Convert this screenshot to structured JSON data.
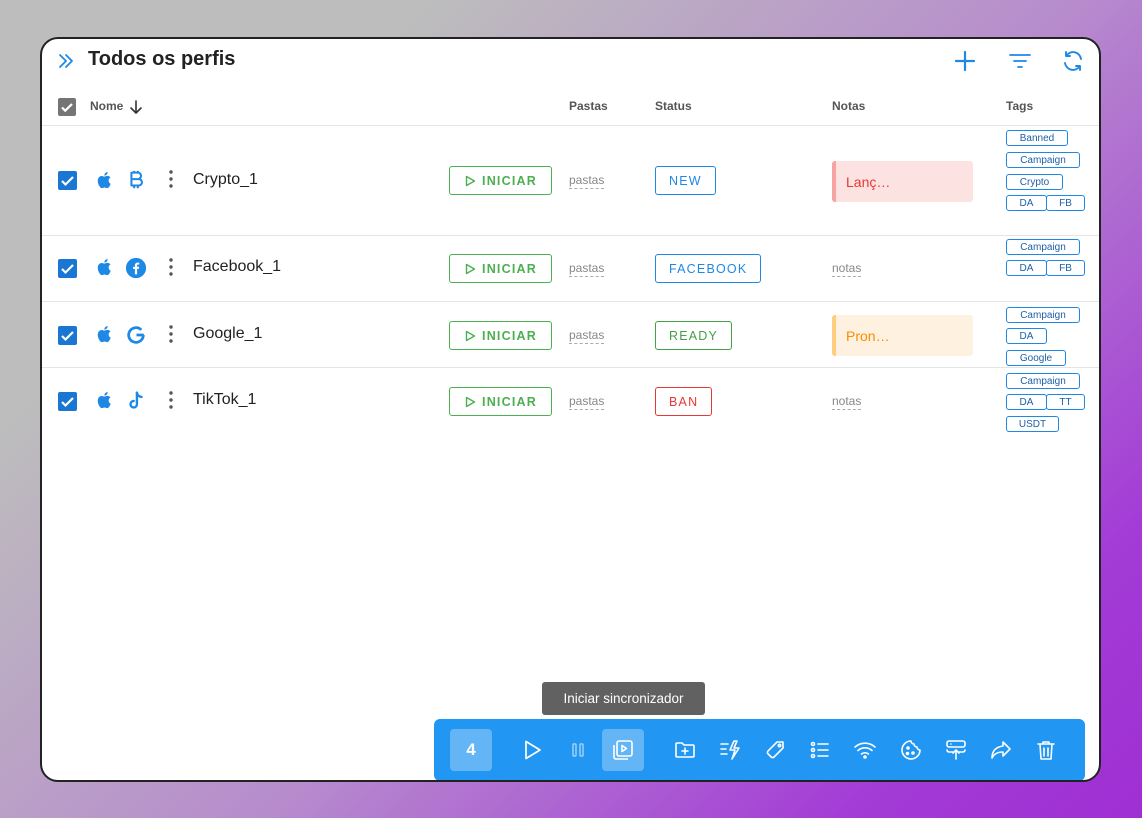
{
  "header": {
    "title": "Todos os perfis"
  },
  "columns": {
    "name": "Nome",
    "folders": "Pastas",
    "status": "Status",
    "notes": "Notas",
    "tags": "Tags"
  },
  "start_label": "INICIAR",
  "folder_link": "pastas",
  "notes_link": "notas",
  "rows": [
    {
      "name": "Crypto_1",
      "os_icon": "apple-icon",
      "site_icon": "bitcoin-icon",
      "status": "NEW",
      "status_color": "#1e88e5",
      "note": "Lanç…",
      "note_color": "#e53935",
      "note_bg": "#fde2e2",
      "note_border": "#f5a3a3",
      "tags": [
        "Banned",
        "Campaign",
        "Crypto",
        "DA",
        "FB"
      ]
    },
    {
      "name": "Facebook_1",
      "os_icon": "apple-icon",
      "site_icon": "facebook-icon",
      "status": "FACEBOOK",
      "status_color": "#1e88e5",
      "note": "",
      "tags": [
        "Campaign",
        "DA",
        "FB"
      ]
    },
    {
      "name": "Google_1",
      "os_icon": "apple-icon",
      "site_icon": "google-icon",
      "status": "READY",
      "status_color": "#43a047",
      "note": "Pron…",
      "note_color": "#fb8c00",
      "note_bg": "#fff1e0",
      "note_border": "#ffcc80",
      "tags": [
        "Campaign",
        "DA",
        "Google"
      ]
    },
    {
      "name": "TikTok_1",
      "os_icon": "apple-icon",
      "site_icon": "tiktok-icon",
      "status": "BAN",
      "status_color": "#e53935",
      "note": "",
      "tags": [
        "Campaign",
        "DA",
        "TT",
        "USDT"
      ]
    }
  ],
  "tooltip": "Iniciar sincronizador",
  "toolbar": {
    "selected_count": "4"
  }
}
